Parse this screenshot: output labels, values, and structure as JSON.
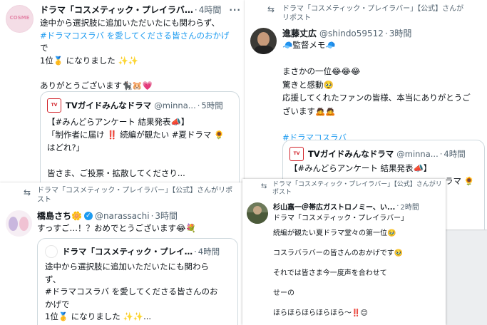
{
  "card1": {
    "name": "ドラマ「コスメティック・プレイラバ…",
    "time": "4時間",
    "lines": [
      "途中から選択肢に追加いただいたにも関わらず、",
      "#ドラマコスラバ を愛してくださる皆さんのおかげ",
      "で",
      "1位🥇 になりました ✨✨",
      "",
      "ありがとうございます🐈‍⬛🐹💗"
    ],
    "quote": {
      "name": "TVガイドみんなドラマ",
      "handle": "@minna...",
      "time": "5時間",
      "logo": "TV",
      "lines": [
        "【#みんどらアンケート 結果発表📣】",
        "「制作者に届け ‼️ 続編が観たい #夏ドラマ 🌻",
        "はどれ?」",
        "",
        "皆さま、ご投票・拡散してくださり..."
      ]
    }
  },
  "card2": {
    "repost": "ドラマ「コスメティック・プレイラバー」【公式】さんがリポスト",
    "name": "進藤丈広",
    "handle": "@shindo59512",
    "time": "3時間",
    "lines": [
      "🧢監督メモ🧢",
      "",
      "まさかの一位😂😂😂",
      "驚きと感動🥹",
      "応援してくれたファンの皆様、本当にありがとうご",
      "ざいます🙇🙇",
      "",
      "#ドラマコスラバ"
    ],
    "quote": {
      "name": "TVガイドみんなドラマ",
      "handle": "@minna...",
      "time": "4時間",
      "lines": [
        "【#みんどらアンケート 結果発表📣】",
        "ラマ 🌻"
      ]
    }
  },
  "card3": {
    "repost": "ドラマ「コスメティック・プレイラバー」【公式】さんがリポスト",
    "name": "橋島さち🌼",
    "handle": "@narassachi",
    "time": "3時間",
    "text": "すっすご…！？おめでとうございます😂💐",
    "quote": {
      "name": "ドラマ「コスメティック・プレイ…",
      "time": "4時間",
      "lines": [
        "途中から選択肢に追加いただいたにも関わら",
        "ず、",
        "#ドラマコスラバ を愛してくださる皆さんのお",
        "かげで",
        "1位🥇 になりました ✨✨..."
      ]
    }
  },
  "card4": {
    "repost": "ドラマ「コスメティック・プレイラバー」【公式】さんがリポスト",
    "name": "杉山嘉一＠帯広ガストロノミー、い...",
    "time": "2時間",
    "reply": "ドラマ「コスメティック・プレイラバー」",
    "lines": [
      "続編が観たい夏ドラマ堂々の第一位🥹",
      "コスラバラバーの皆さんのおかげです🥹",
      "それでは皆さま今一度声を合わせて",
      "せーの",
      "ほらほらほらほらほら〜‼️😊"
    ]
  },
  "icons": {
    "more": "more-icon",
    "repost": "repost-icon",
    "verified": "verified-badge-icon"
  },
  "colors": {
    "link": "#1d9bf0",
    "muted": "#536471",
    "text": "#0f1419"
  }
}
